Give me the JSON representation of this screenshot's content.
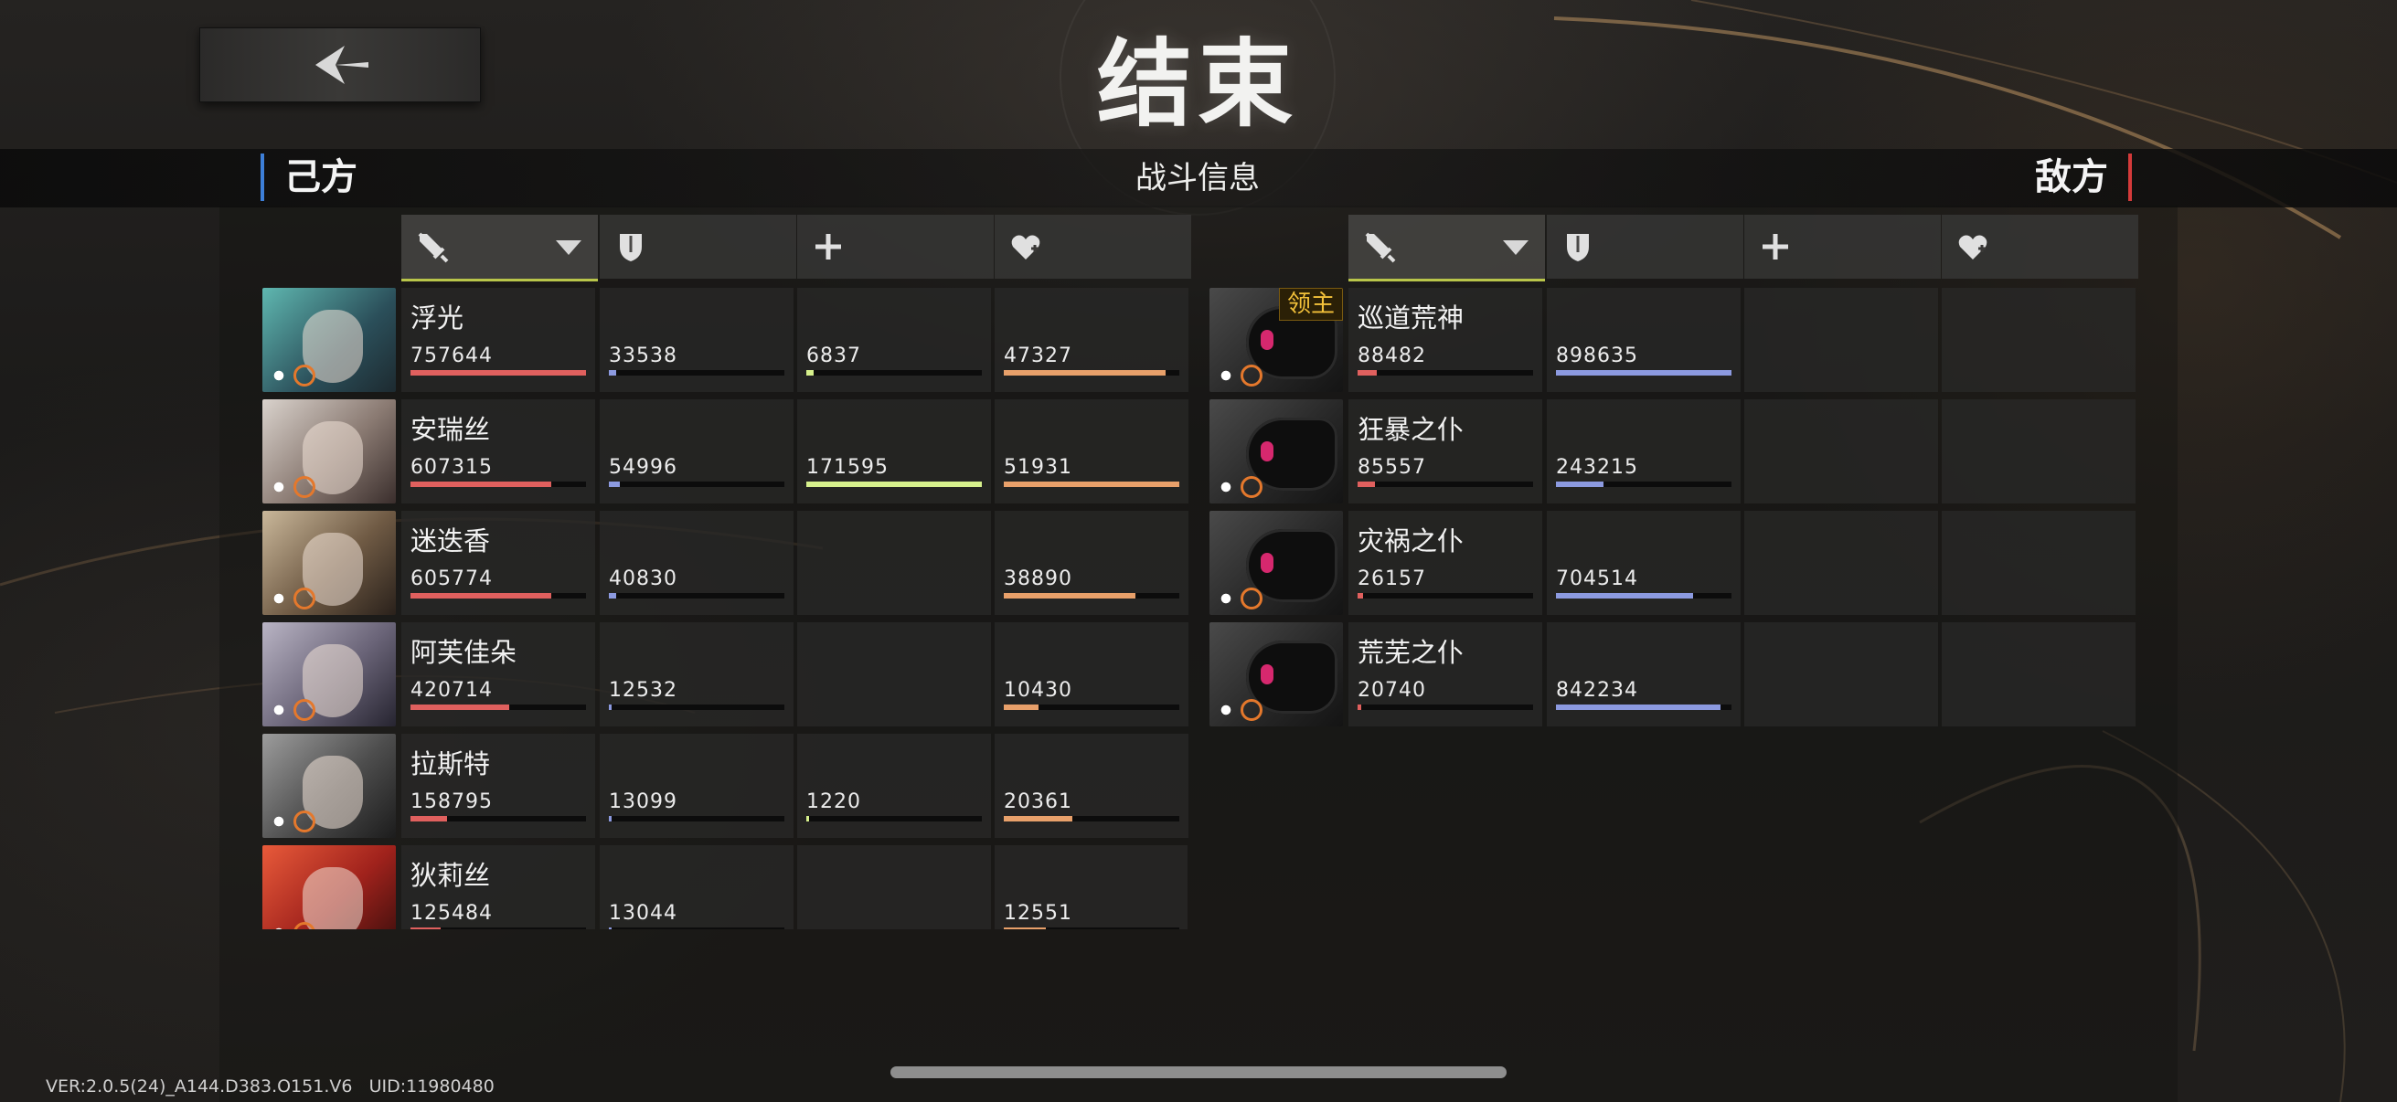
{
  "title": "结束",
  "subtitle": "战斗信息",
  "left_side_label": "己方",
  "right_side_label": "敌方",
  "version": "VER:2.0.5(24)_A144.D383.O151.V6",
  "uid": "UID:11980480",
  "boss_badge": "领主",
  "columns": [
    {
      "icon": "sword-icon",
      "sorted": true
    },
    {
      "icon": "shield-icon",
      "sorted": false
    },
    {
      "icon": "plus-heal-icon",
      "sorted": false
    },
    {
      "icon": "heart-plus-icon",
      "sorted": false
    }
  ],
  "colors": {
    "damage": "#e0605e",
    "shield": "#8c9ae0",
    "heal": "#d6f08c",
    "received": "#e8a06a",
    "ally_accent": "#3d7fd8",
    "enemy_accent": "#d43a3a",
    "sort_underline": "#b9c54a",
    "boss_text": "#f3c13a"
  },
  "allies": [
    {
      "name": "浮光",
      "damage": "757644",
      "damage_pct": 1.0,
      "shield": "33538",
      "shield_pct": 0.04,
      "heal": "6837",
      "heal_pct": 0.04,
      "received": "47327",
      "received_pct": 0.92
    },
    {
      "name": "安瑞丝",
      "damage": "607315",
      "damage_pct": 0.8,
      "shield": "54996",
      "shield_pct": 0.06,
      "heal": "171595",
      "heal_pct": 1.0,
      "received": "51931",
      "received_pct": 1.0
    },
    {
      "name": "迷迭香",
      "damage": "605774",
      "damage_pct": 0.8,
      "shield": "40830",
      "shield_pct": 0.04,
      "heal": "",
      "heal_pct": 0,
      "received": "38890",
      "received_pct": 0.75
    },
    {
      "name": "阿芙佳朵",
      "damage": "420714",
      "damage_pct": 0.56,
      "shield": "12532",
      "shield_pct": 0.015,
      "heal": "",
      "heal_pct": 0,
      "received": "10430",
      "received_pct": 0.2
    },
    {
      "name": "拉斯特",
      "damage": "158795",
      "damage_pct": 0.21,
      "shield": "13099",
      "shield_pct": 0.015,
      "heal": "1220",
      "heal_pct": 0.01,
      "received": "20361",
      "received_pct": 0.39
    },
    {
      "name": "狄莉丝",
      "damage": "125484",
      "damage_pct": 0.17,
      "shield": "13044",
      "shield_pct": 0.015,
      "heal": "",
      "heal_pct": 0,
      "received": "12551",
      "received_pct": 0.24
    }
  ],
  "enemies": [
    {
      "name": "巡道荒神",
      "boss": true,
      "damage": "88482",
      "damage_pct": 0.11,
      "shield": "898635",
      "shield_pct": 1.0
    },
    {
      "name": "狂暴之仆",
      "boss": false,
      "damage": "85557",
      "damage_pct": 0.1,
      "shield": "243215",
      "shield_pct": 0.27
    },
    {
      "name": "灾祸之仆",
      "boss": false,
      "damage": "26157",
      "damage_pct": 0.03,
      "shield": "704514",
      "shield_pct": 0.78
    },
    {
      "name": "荒芜之仆",
      "boss": false,
      "damage": "20740",
      "damage_pct": 0.02,
      "shield": "842234",
      "shield_pct": 0.94
    }
  ]
}
